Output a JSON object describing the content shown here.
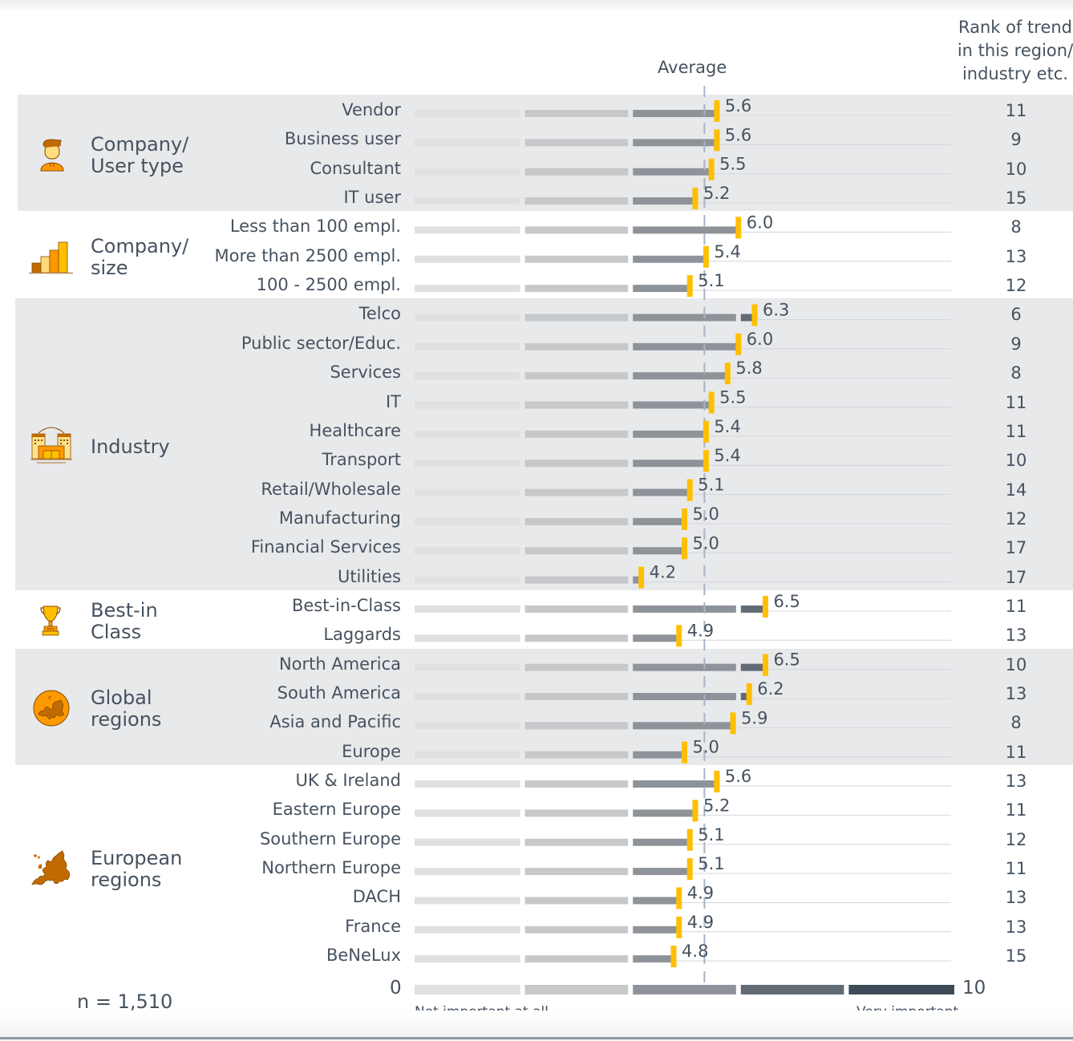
{
  "chart_data": {
    "type": "bar",
    "title": "",
    "xlabel": "",
    "ylabel": "",
    "xlim": [
      0,
      10
    ],
    "average": 5.37,
    "average_label": "Average",
    "rank_header": [
      "Rank of trend",
      "in this region/",
      "industry etc."
    ],
    "scale": {
      "min_label": "0",
      "max_label": "10",
      "low_caption": "Not important at all",
      "high_caption": "Very important",
      "segment_colors": [
        "#dfe0e2",
        "#c6c8ca",
        "#8e9399",
        "#626b74",
        "#3f4b58"
      ]
    },
    "marker_color": "#ffbf00",
    "groups": [
      {
        "name": "Company/\nUser type",
        "icon": "user-icon",
        "shaded": true,
        "rows": [
          {
            "label": "Vendor",
            "value": 5.6,
            "rank": 11
          },
          {
            "label": "Business user",
            "value": 5.6,
            "rank": 9
          },
          {
            "label": "Consultant",
            "value": 5.5,
            "rank": 10
          },
          {
            "label": "IT user",
            "value": 5.2,
            "rank": 15
          }
        ]
      },
      {
        "name": "Company/\nsize",
        "icon": "bar-chart-icon",
        "shaded": false,
        "rows": [
          {
            "label": "Less than 100 empl.",
            "value": 6.0,
            "rank": 8
          },
          {
            "label": "More than 2500 empl.",
            "value": 5.4,
            "rank": 13
          },
          {
            "label": "100 - 2500 empl.",
            "value": 5.1,
            "rank": 12
          }
        ]
      },
      {
        "name": "Industry",
        "icon": "buildings-icon",
        "shaded": true,
        "rows": [
          {
            "label": "Telco",
            "value": 6.3,
            "rank": 6
          },
          {
            "label": "Public sector/Educ.",
            "value": 6.0,
            "rank": 9
          },
          {
            "label": "Services",
            "value": 5.8,
            "rank": 8
          },
          {
            "label": "IT",
            "value": 5.5,
            "rank": 11
          },
          {
            "label": "Healthcare",
            "value": 5.4,
            "rank": 11
          },
          {
            "label": "Transport",
            "value": 5.4,
            "rank": 10
          },
          {
            "label": "Retail/Wholesale",
            "value": 5.1,
            "rank": 14
          },
          {
            "label": "Manufacturing",
            "value": 5.0,
            "rank": 12
          },
          {
            "label": "Financial Services",
            "value": 5.0,
            "rank": 17
          },
          {
            "label": "Utilities",
            "value": 4.2,
            "rank": 17
          }
        ]
      },
      {
        "name": "Best-in\nClass",
        "icon": "trophy-icon",
        "shaded": false,
        "rows": [
          {
            "label": "Best-in-Class",
            "value": 6.5,
            "rank": 11
          },
          {
            "label": "Laggards",
            "value": 4.9,
            "rank": 13
          }
        ]
      },
      {
        "name": "Global\nregions",
        "icon": "globe-icon",
        "shaded": true,
        "rows": [
          {
            "label": "North America",
            "value": 6.5,
            "rank": 10
          },
          {
            "label": "South America",
            "value": 6.2,
            "rank": 13
          },
          {
            "label": "Asia and Pacific",
            "value": 5.9,
            "rank": 8
          },
          {
            "label": "Europe",
            "value": 5.0,
            "rank": 11
          }
        ]
      },
      {
        "name": "European\nregions",
        "icon": "europe-map-icon",
        "shaded": false,
        "rows": [
          {
            "label": "UK & Ireland",
            "value": 5.6,
            "rank": 13
          },
          {
            "label": "Eastern Europe",
            "value": 5.2,
            "rank": 11
          },
          {
            "label": "Southern Europe",
            "value": 5.1,
            "rank": 12
          },
          {
            "label": "Northern Europe",
            "value": 5.1,
            "rank": 11
          },
          {
            "label": "DACH",
            "value": 4.9,
            "rank": 13
          },
          {
            "label": "France",
            "value": 4.9,
            "rank": 13
          },
          {
            "label": "BeNeLux",
            "value": 4.8,
            "rank": 15
          }
        ]
      }
    ]
  },
  "footer": {
    "sample_size": "n = 1,510"
  }
}
